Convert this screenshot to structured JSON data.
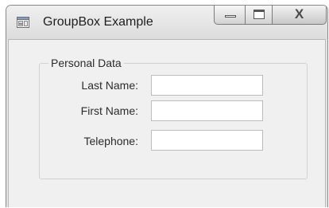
{
  "window": {
    "title": "GroupBox Example",
    "close_glyph": "X"
  },
  "groupbox": {
    "title": "Personal Data",
    "fields": [
      {
        "label": "Last Name:",
        "value": ""
      },
      {
        "label": "First Name:",
        "value": ""
      },
      {
        "label": "Telephone:",
        "value": ""
      }
    ]
  },
  "icons": {
    "app": "form-window-icon",
    "minimize": "minimize-icon",
    "maximize": "maximize-icon",
    "close": "close-icon"
  },
  "colors": {
    "client_background": "#f0f0f0",
    "title_text": "#1e1e1e",
    "input_border": "#bcbcbc"
  }
}
